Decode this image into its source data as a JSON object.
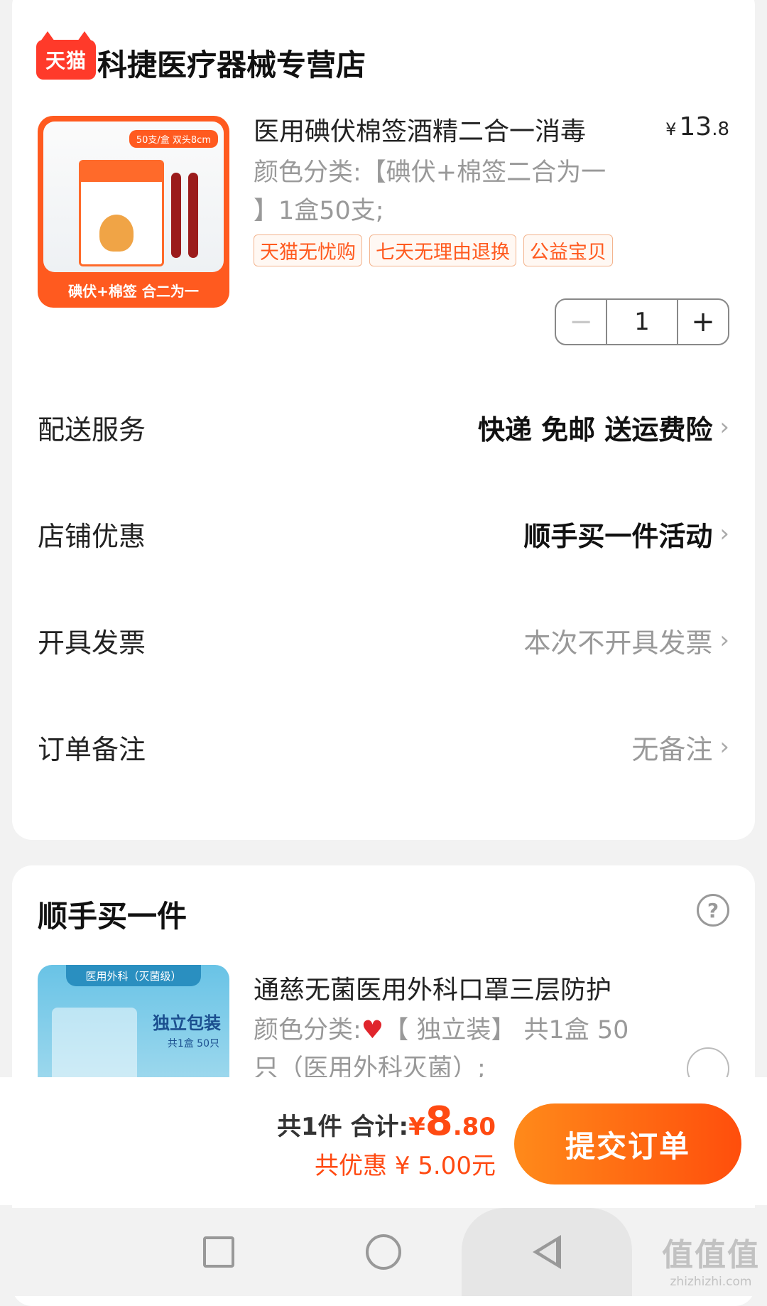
{
  "store": {
    "logo_text": "天猫",
    "name": "科捷医疗器械专营店"
  },
  "product": {
    "image": {
      "tag": "50支/盒 双头8cm",
      "footer": "碘伏+棉签 合二为一"
    },
    "title": "医用碘伏棉签酒精二合一消毒",
    "price_symbol": "¥",
    "price_int": "13",
    "price_dec": ".8",
    "spec": "颜色分类:【碘伏+棉签二合为一 】1盒50支;",
    "badges": [
      "天猫无忧购",
      "七天无理由退换",
      "公益宝贝"
    ],
    "quantity": "1",
    "minus": "−",
    "plus": "+"
  },
  "options": [
    {
      "label": "配送服务",
      "value": "快递 免邮 送运费险"
    },
    {
      "label": "店铺优惠",
      "value": "顺手买一件活动"
    },
    {
      "label": "开具发票",
      "value": "本次不开具发票"
    },
    {
      "label": "订单备注",
      "value": "无备注"
    }
  ],
  "addon": {
    "section_title": "顺手买一件",
    "help": "?",
    "image": {
      "banner": "医用外科（灭菌级）",
      "headline": "独立包装",
      "sub": "共1盒 50只"
    },
    "title": "通慈无菌医用外科口罩三层防护",
    "spec_prefix": "颜色分类:",
    "spec_heart": "♥",
    "spec_rest": "【 独立装】 共1盒 50只（医用外科灭菌）;"
  },
  "checkout": {
    "count_label": "共1件",
    "total_label": "合计:",
    "total_symbol": "¥",
    "total_int": "8",
    "total_dec": ".80",
    "discount": "共优惠 ¥ 5.00元",
    "submit": "提交订单"
  },
  "watermark": {
    "main": "值值值",
    "url": "zhizhizhi.com"
  },
  "colors": {
    "accent": "#ff4a12",
    "tmall_red": "#ff3a2a",
    "muted": "#999999"
  }
}
